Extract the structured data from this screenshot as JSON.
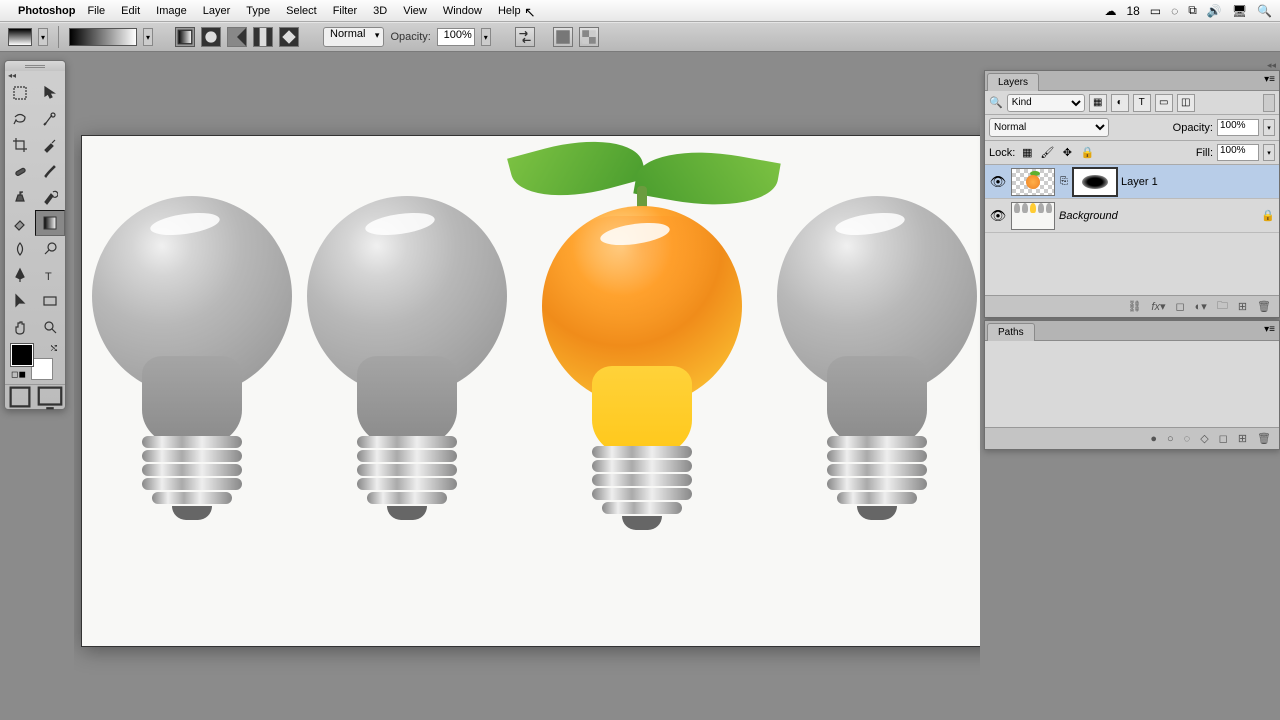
{
  "menubar": {
    "app": "Photoshop",
    "items": [
      "File",
      "Edit",
      "Image",
      "Layer",
      "Type",
      "Select",
      "Filter",
      "3D",
      "View",
      "Window",
      "Help"
    ],
    "status_number": "18"
  },
  "optionsbar": {
    "mode": "Normal",
    "opacity_label": "Opacity:",
    "opacity_value": "100%"
  },
  "layers_panel": {
    "tab": "Layers",
    "filter_kind": "Kind",
    "blend_mode": "Normal",
    "opacity_label": "Opacity:",
    "opacity_value": "100%",
    "lock_label": "Lock:",
    "fill_label": "Fill:",
    "fill_value": "100%",
    "layers": [
      {
        "name": "Layer 1",
        "locked": false,
        "selected": true,
        "has_mask": true
      },
      {
        "name": "Background",
        "locked": true,
        "selected": false,
        "italic": true
      }
    ]
  },
  "paths_panel": {
    "tab": "Paths"
  }
}
